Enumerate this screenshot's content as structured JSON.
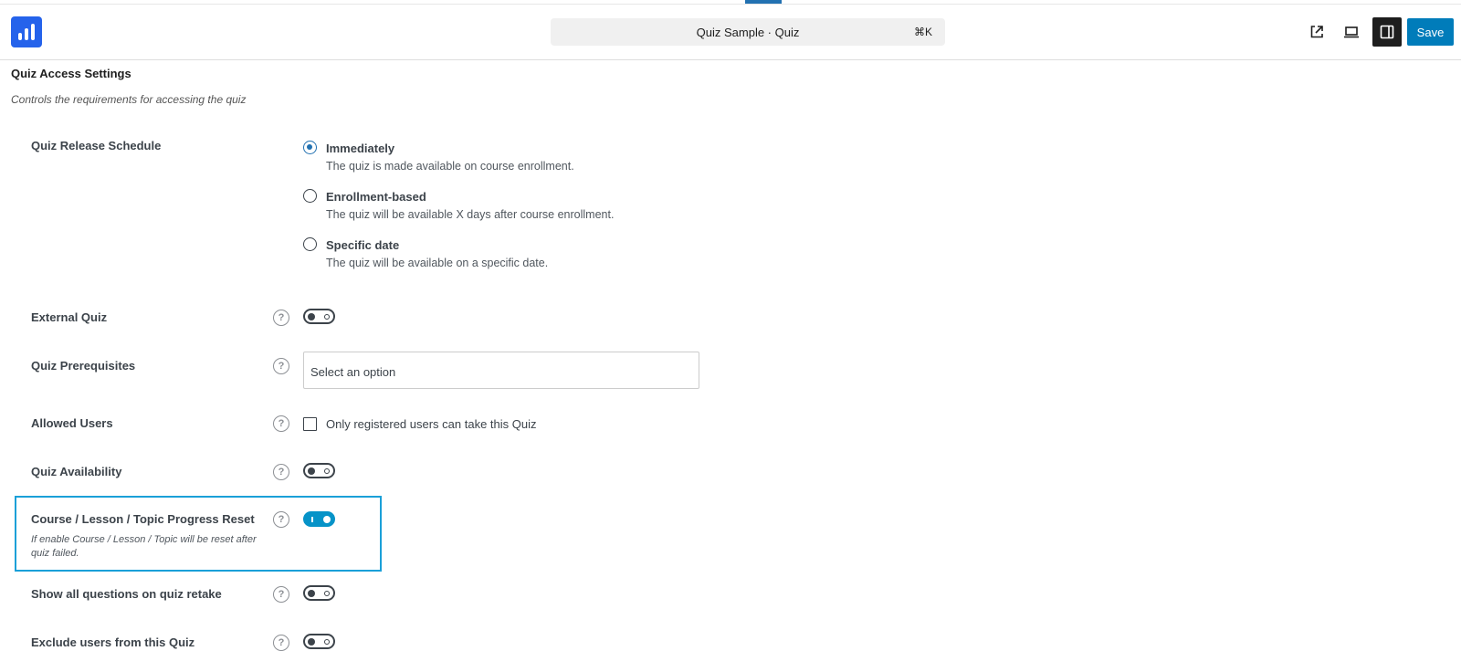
{
  "header": {
    "logo": "chart-logo-icon",
    "command_title": "Quiz Sample · Quiz",
    "command_shortcut": "⌘K",
    "save_label": "Save",
    "accent_color": "#007cba"
  },
  "section": {
    "title": "Quiz Access Settings",
    "description": "Controls the requirements for accessing the quiz"
  },
  "release": {
    "label": "Quiz Release Schedule",
    "options": [
      {
        "label": "Immediately",
        "description": "The quiz is made available on course enrollment.",
        "checked": true
      },
      {
        "label": "Enrollment-based",
        "description": "The quiz will be available X days after course enrollment.",
        "checked": false
      },
      {
        "label": "Specific date",
        "description": "The quiz will be available on a specific date.",
        "checked": false
      }
    ]
  },
  "settings": {
    "external_quiz": {
      "label": "External Quiz",
      "enabled": false
    },
    "prerequisites": {
      "label": "Quiz Prerequisites",
      "placeholder": "Select an option"
    },
    "allowed_users": {
      "label": "Allowed Users",
      "checkbox_label": "Only registered users can take this Quiz",
      "checked": false
    },
    "availability": {
      "label": "Quiz Availability",
      "enabled": false
    },
    "progress_reset": {
      "label": "Course / Lesson / Topic Progress Reset",
      "description": "If enable Course / Lesson / Topic will be reset after quiz failed.",
      "enabled": true,
      "highlight_color": "#1aa0d8"
    },
    "show_all_questions": {
      "label": "Show all questions on quiz retake",
      "enabled": false
    },
    "exclude_users": {
      "label": "Exclude users from this Quiz",
      "enabled": false
    }
  },
  "help_symbol": "?"
}
